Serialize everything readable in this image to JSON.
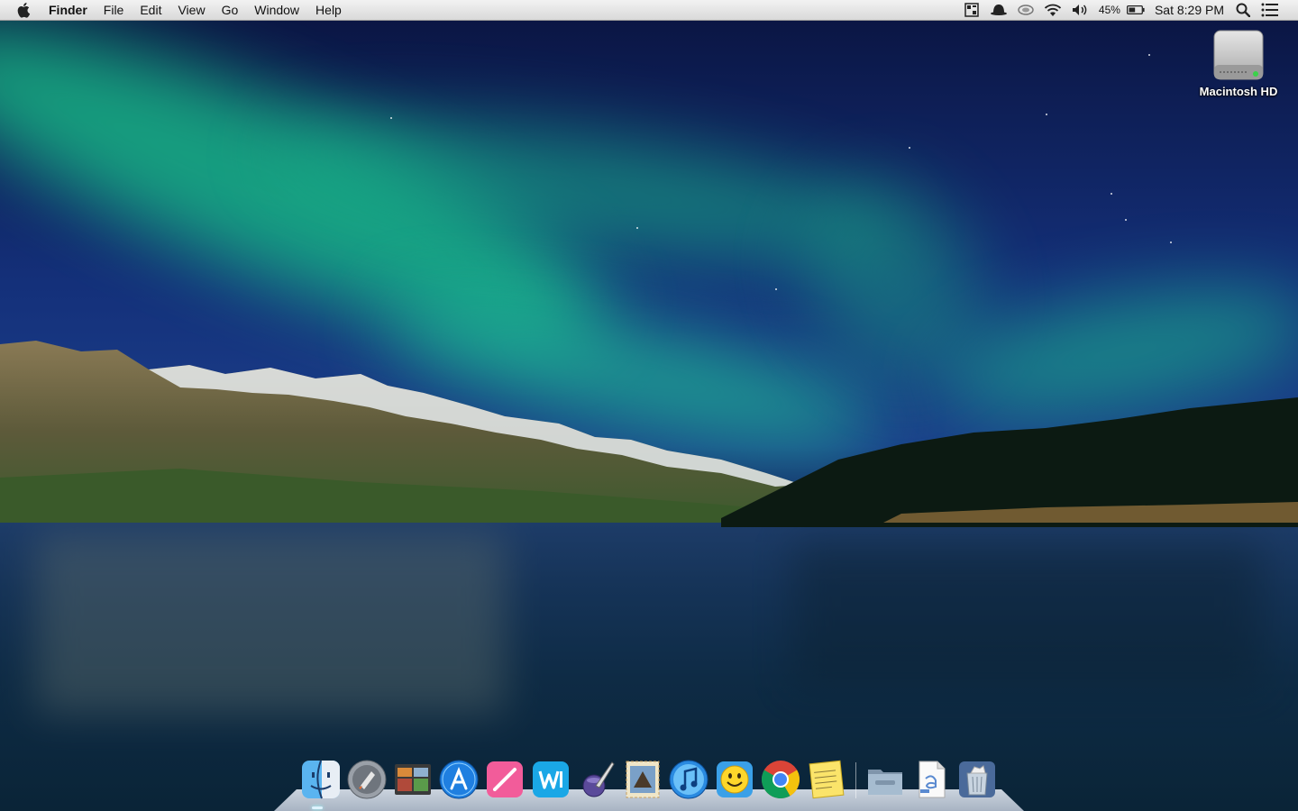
{
  "menubar": {
    "app_name": "Finder",
    "menus": [
      "File",
      "Edit",
      "View",
      "Go",
      "Window",
      "Help"
    ],
    "battery_percent": "45%",
    "clock": "Sat 8:29 PM"
  },
  "desktop": {
    "icons": [
      {
        "label": "Macintosh HD",
        "icon": "hard-drive-icon"
      }
    ]
  },
  "dock": {
    "apps": [
      {
        "name": "Finder",
        "icon": "finder-icon",
        "running": true
      },
      {
        "name": "Launchpad",
        "icon": "launchpad-icon",
        "running": false
      },
      {
        "name": "Photo Browser",
        "icon": "photo-app-icon",
        "running": false
      },
      {
        "name": "App Store",
        "icon": "app-store-icon",
        "running": false
      },
      {
        "name": "Drawing App",
        "icon": "pen-app-icon",
        "running": false
      },
      {
        "name": "Word Processor",
        "icon": "word-app-icon",
        "running": false
      },
      {
        "name": "Script Editor",
        "icon": "quill-app-icon",
        "running": false
      },
      {
        "name": "Mail",
        "icon": "mail-stamp-icon",
        "running": false
      },
      {
        "name": "iTunes",
        "icon": "itunes-icon",
        "running": false
      },
      {
        "name": "Messenger",
        "icon": "smiley-app-icon",
        "running": false
      },
      {
        "name": "Google Chrome",
        "icon": "chrome-icon",
        "running": false
      },
      {
        "name": "Stickies",
        "icon": "notes-icon",
        "running": false
      }
    ],
    "stacks": [
      {
        "name": "Documents",
        "icon": "folder-stack-icon"
      },
      {
        "name": "Downloads",
        "icon": "document-stack-icon"
      },
      {
        "name": "Trash",
        "icon": "trash-icon"
      }
    ]
  },
  "colors": {
    "sky_top": "#0a1440",
    "aurora": "#19c58a",
    "lake": "#153357",
    "menubar": "#e6e6e6"
  }
}
